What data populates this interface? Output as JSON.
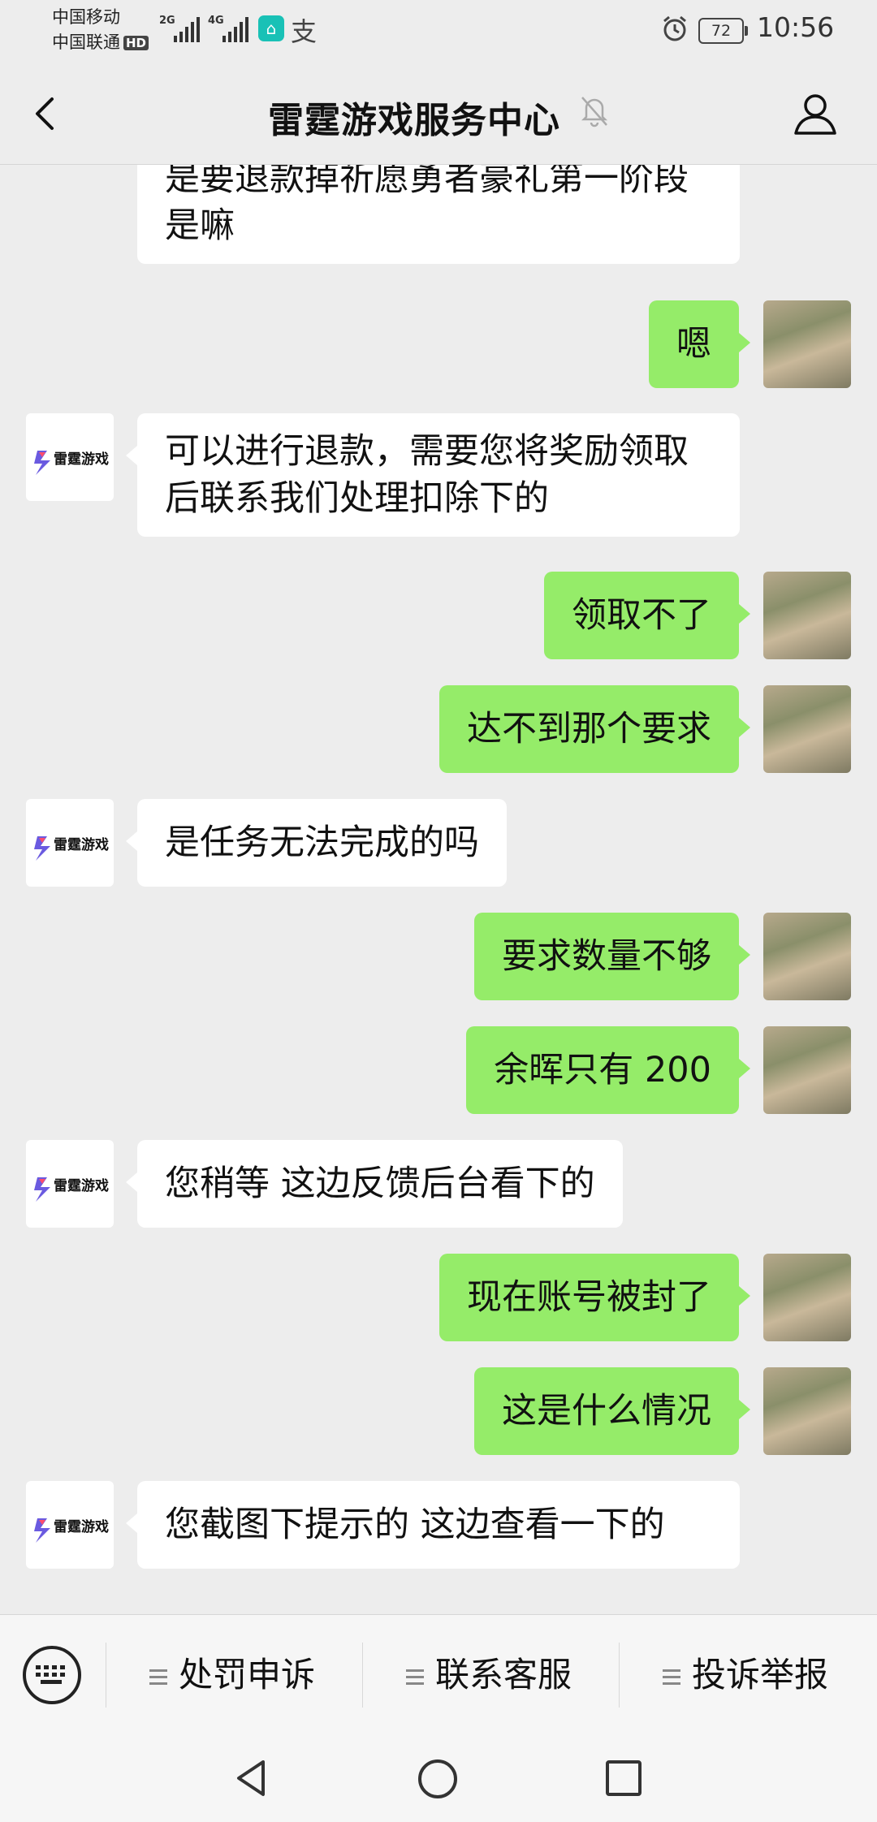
{
  "status_bar": {
    "carrier1": "中国移动",
    "carrier2": "中国联通",
    "hd": "HD",
    "net1": "2G",
    "net2": "4G",
    "battery": "72",
    "time": "10:56"
  },
  "header": {
    "title": "雷霆游戏服务中心"
  },
  "bot_logo_text": "雷霆游戏",
  "messages": [
    {
      "side": "in",
      "text": "是要退款掉祈愿勇者豪礼第一阶段是嘛"
    },
    {
      "side": "out",
      "text": "嗯"
    },
    {
      "side": "in",
      "text": "可以进行退款，需要您将奖励领取后联系我们处理扣除下的"
    },
    {
      "side": "out",
      "text": "领取不了"
    },
    {
      "side": "out",
      "text": "达不到那个要求"
    },
    {
      "side": "in",
      "text": "是任务无法完成的吗"
    },
    {
      "side": "out",
      "text": "要求数量不够"
    },
    {
      "side": "out",
      "text": "余晖只有 200"
    },
    {
      "side": "in",
      "text": "您稍等 这边反馈后台看下的"
    },
    {
      "side": "out",
      "text": "现在账号被封了"
    },
    {
      "side": "out",
      "text": "这是什么情况"
    },
    {
      "side": "in",
      "text": "您截图下提示的 这边查看一下的"
    }
  ],
  "menu": {
    "items": [
      "处罚申诉",
      "联系客服",
      "投诉举报"
    ]
  },
  "icons": {
    "back": "back-arrow-icon",
    "mute": "muted-bell-icon",
    "profile": "profile-icon",
    "keyboard": "keyboard-icon",
    "nav_back": "nav-back-icon",
    "nav_home": "nav-home-icon",
    "nav_recent": "nav-recent-icon"
  },
  "colors": {
    "outgoing_bubble": "#95ec69",
    "incoming_bubble": "#ffffff",
    "background": "#ededed"
  }
}
